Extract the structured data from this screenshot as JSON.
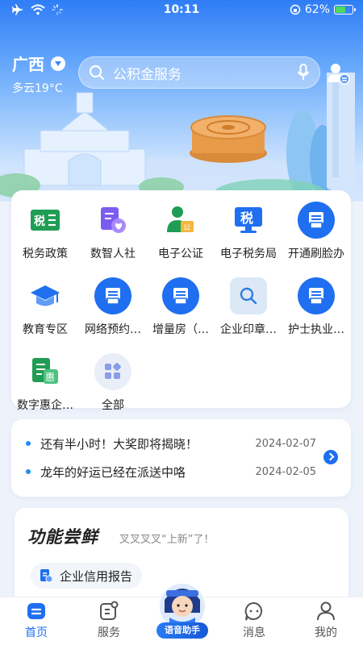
{
  "status": {
    "time": "10:11",
    "battery": "62%",
    "battery_level": 0.62
  },
  "location": {
    "city": "广西",
    "weather": "多云19°C"
  },
  "search": {
    "placeholder": "公积金服务"
  },
  "services": [
    {
      "label": "税务政策",
      "icon": "tax-policy-icon"
    },
    {
      "label": "数智人社",
      "icon": "social-security-icon"
    },
    {
      "label": "电子公证",
      "icon": "notary-icon"
    },
    {
      "label": "电子税务局",
      "icon": "tax-bureau-icon"
    },
    {
      "label": "开通刷脸办",
      "icon": "printer-icon"
    },
    {
      "label": "教育专区",
      "icon": "graduation-cap-icon"
    },
    {
      "label": "网络预约…",
      "icon": "printer-icon"
    },
    {
      "label": "增量房（…",
      "icon": "printer-icon"
    },
    {
      "label": "企业印章…",
      "icon": "search-icon"
    },
    {
      "label": "护士执业…",
      "icon": "printer-icon"
    },
    {
      "label": "数字惠企…",
      "icon": "benefit-icon"
    },
    {
      "label": "全部",
      "icon": "grid-icon"
    }
  ],
  "news": [
    {
      "title": "还有半小时！大奖即将揭晓！",
      "date": "2024-02-07"
    },
    {
      "title": "龙年的好运已经在派送中咯",
      "date": "2024-02-05"
    }
  ],
  "new_features": {
    "title": "功能尝鲜",
    "subtitle": "叉叉叉叉“上新”了！",
    "chip": "企业信用报告"
  },
  "tabs": [
    {
      "label": "首页",
      "icon": "home-icon",
      "active": true
    },
    {
      "label": "服务",
      "icon": "service-icon",
      "active": false
    },
    {
      "label": "消息",
      "icon": "message-icon",
      "active": false
    },
    {
      "label": "我的",
      "icon": "profile-icon",
      "active": false
    }
  ],
  "voice_assistant": {
    "label": "语音助手"
  },
  "colors": {
    "primary": "#1f6ff0",
    "green": "#1f9d55",
    "purple": "#7b5cf0"
  }
}
